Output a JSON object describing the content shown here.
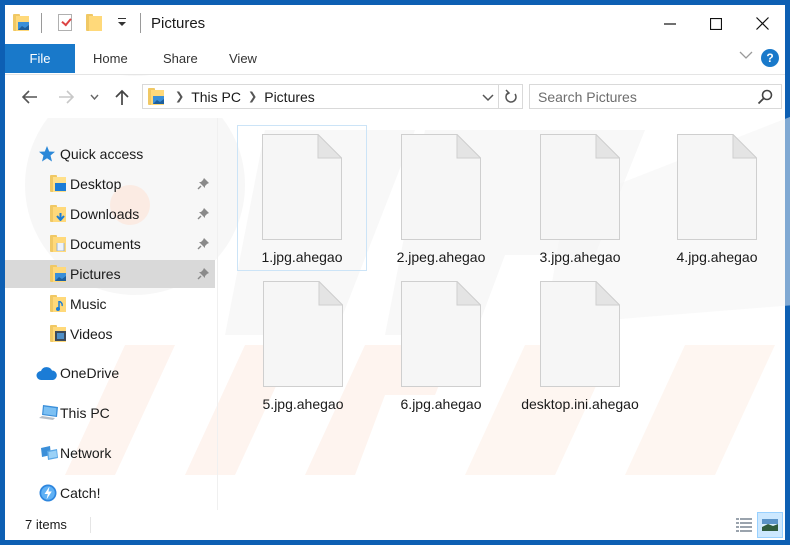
{
  "window": {
    "title": "Pictures",
    "controls": {
      "minimize": "minimize-icon",
      "maximize": "maximize-icon",
      "close": "close-icon"
    }
  },
  "ribbon": {
    "tabs": [
      {
        "label": "File",
        "active": true
      },
      {
        "label": "Home"
      },
      {
        "label": "Share"
      },
      {
        "label": "View"
      }
    ],
    "help_label": "?",
    "accent_color": "#1979ca"
  },
  "address": {
    "crumbs": [
      "This PC",
      "Pictures"
    ]
  },
  "search": {
    "placeholder": "Search Pictures",
    "value": ""
  },
  "sidebar": {
    "items": [
      {
        "label": "Quick access",
        "icon": "star-icon",
        "level": 0
      },
      {
        "label": "Desktop",
        "icon": "desktop-folder-icon",
        "level": 1,
        "pinned": true
      },
      {
        "label": "Downloads",
        "icon": "downloads-folder-icon",
        "level": 1,
        "pinned": true
      },
      {
        "label": "Documents",
        "icon": "documents-folder-icon",
        "level": 1,
        "pinned": true
      },
      {
        "label": "Pictures",
        "icon": "pictures-folder-icon",
        "level": 1,
        "pinned": true,
        "selected": true
      },
      {
        "label": "Music",
        "icon": "music-folder-icon",
        "level": 1
      },
      {
        "label": "Videos",
        "icon": "videos-folder-icon",
        "level": 1
      },
      {
        "label": "OneDrive",
        "icon": "cloud-icon",
        "level": 0
      },
      {
        "label": "This PC",
        "icon": "computer-icon",
        "level": 0
      },
      {
        "label": "Network",
        "icon": "network-icon",
        "level": 0
      },
      {
        "label": "Catch!",
        "icon": "catch-icon",
        "level": 0
      }
    ]
  },
  "files": [
    {
      "name": "1.jpg.ahegao",
      "focused": true
    },
    {
      "name": "2.jpeg.ahegao"
    },
    {
      "name": "3.jpg.ahegao"
    },
    {
      "name": "4.jpg.ahegao"
    },
    {
      "name": "5.jpg.ahegao"
    },
    {
      "name": "6.jpg.ahegao"
    },
    {
      "name": "desktop.ini.ahegao"
    }
  ],
  "status": {
    "item_count": "7 items"
  }
}
